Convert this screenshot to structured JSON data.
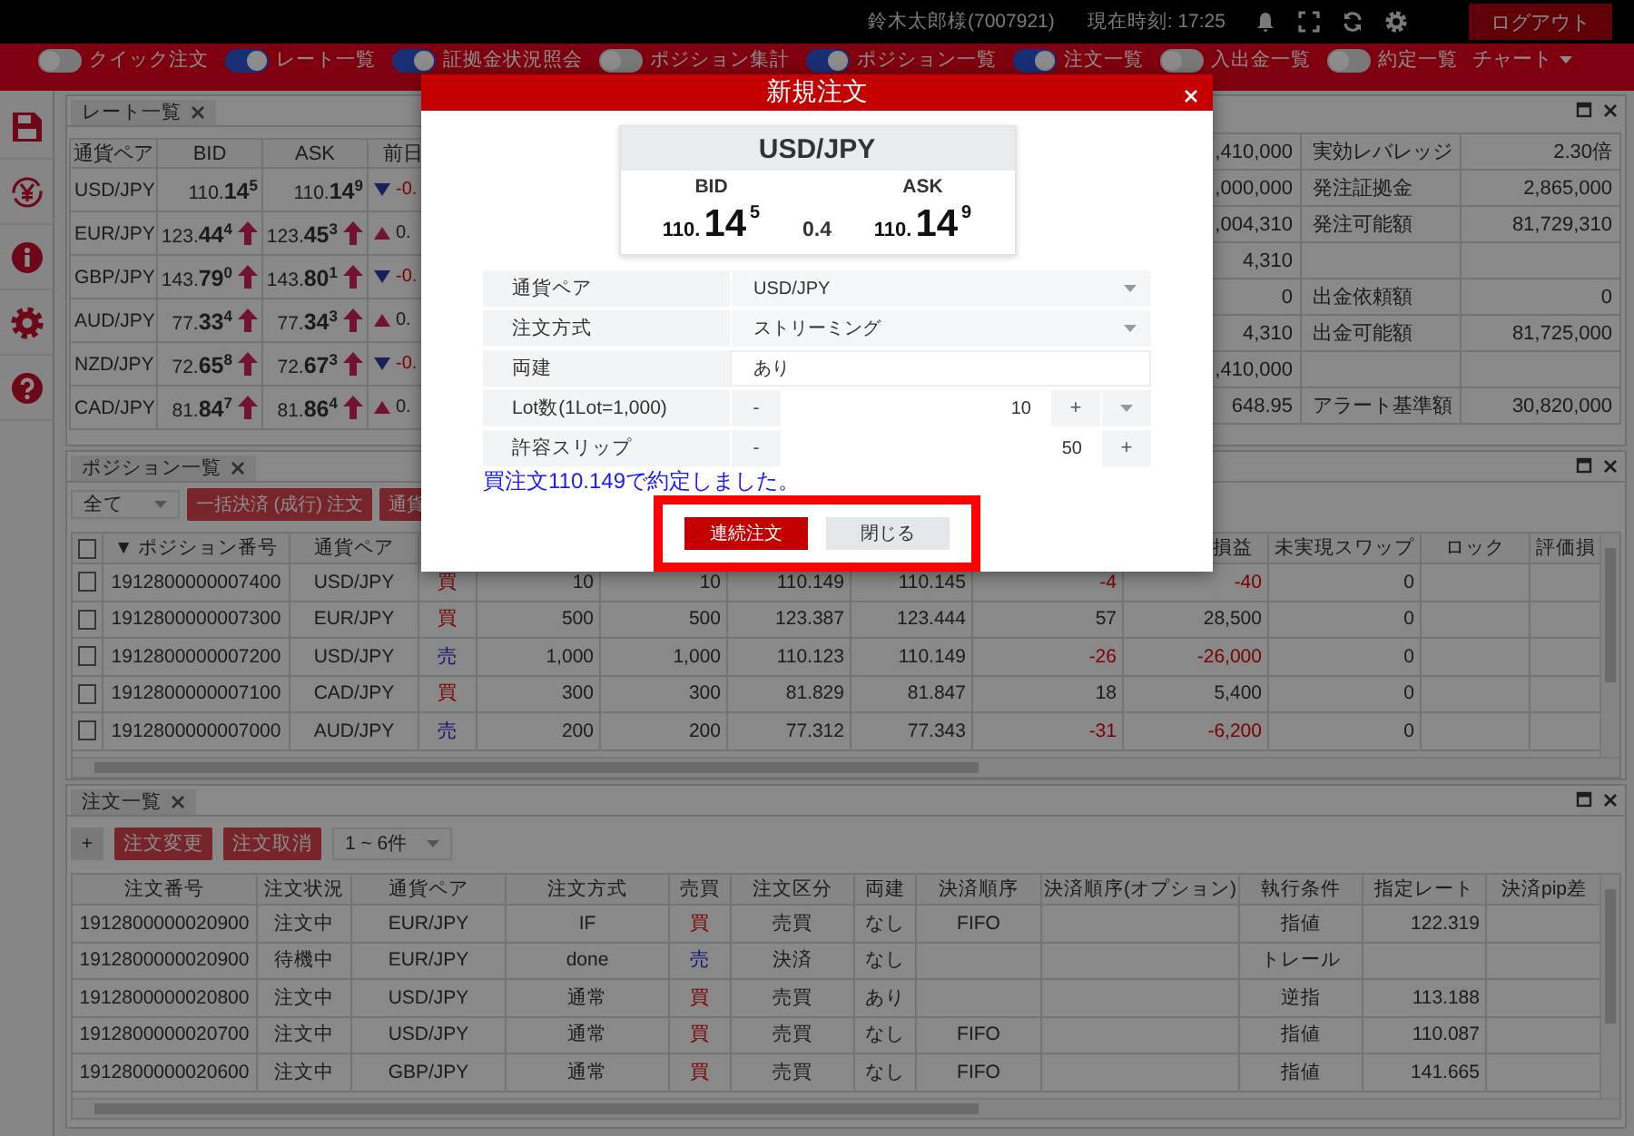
{
  "top_bar": {
    "user": "鈴木太郎様(7007921)",
    "clock": "現在時刻: 17:25",
    "logout": "ログアウト"
  },
  "nav": {
    "toggles": [
      {
        "label": "クイック注文",
        "on": false
      },
      {
        "label": "レート一覧",
        "on": true
      },
      {
        "label": "証拠金状況照会",
        "on": true
      },
      {
        "label": "ポジション集計",
        "on": false
      },
      {
        "label": "ポジション一覧",
        "on": true
      },
      {
        "label": "注文一覧",
        "on": true
      },
      {
        "label": "入出金一覧",
        "on": false
      },
      {
        "label": "約定一覧",
        "on": false
      }
    ],
    "chart_menu": "チャート"
  },
  "rate_panel": {
    "tab": "レート一覧",
    "columns": [
      "通貨ペア",
      "BID",
      "ASK",
      "前日"
    ],
    "rows": [
      {
        "pair": "USD/JPY",
        "bid": "110.**14**$^{5}$",
        "bid_up": false,
        "ask": "110.**14**$^{9}$",
        "ask_up": false,
        "change_down": true,
        "change": "-0."
      },
      {
        "pair": "EUR/JPY",
        "bid": "123.**44**$^{4}$",
        "bid_up": true,
        "ask": "123.**45**$^{3}$",
        "ask_up": true,
        "change_down": false,
        "change": "0."
      },
      {
        "pair": "GBP/JPY",
        "bid": "143.**79**$^{0}$",
        "bid_up": true,
        "ask": "143.**80**$^{1}$",
        "ask_up": true,
        "change_down": true,
        "change": "-0."
      },
      {
        "pair": "AUD/JPY",
        "bid": "77.**33**$^{4}$",
        "bid_up": true,
        "ask": "77.**34**$^{3}$",
        "ask_up": true,
        "change_down": false,
        "change": "0."
      },
      {
        "pair": "NZD/JPY",
        "bid": "72.**65**$^{8}$",
        "bid_up": true,
        "ask": "72.**67**$^{3}$",
        "ask_up": true,
        "change_down": true,
        "change": "-0."
      },
      {
        "pair": "CAD/JPY",
        "bid": "81.**84**$^{7}$",
        "bid_up": true,
        "ask": "81.**86**$^{4}$",
        "ask_up": true,
        "change_down": false,
        "change": "0."
      }
    ]
  },
  "account_panel": {
    "rows": [
      {
        "value_1": ",410,000",
        "label_2": "実効レバレッジ",
        "value_2": "2.30倍"
      },
      {
        "value_1": ",000,000",
        "label_2": "発注証拠金",
        "value_2": "2,865,000"
      },
      {
        "value_1": ",004,310",
        "label_2": "発注可能額",
        "value_2": "81,729,310"
      },
      {
        "value_1": "4,310"
      },
      {
        "value_1": "0",
        "label_2": "出金依頼額",
        "value_2": "0"
      },
      {
        "value_1": "4,310",
        "label_2": "出金可能額",
        "value_2": "81,725,000"
      },
      {
        "value_1": ",410,000"
      },
      {
        "value_1": "648.95",
        "label_2": "アラート基準額",
        "value_2": "30,820,000"
      }
    ]
  },
  "position_panel": {
    "tab": "ポジション一覧",
    "filter": "全て",
    "buttons": [
      "一括決済 (成行) 注文",
      "通貨"
    ],
    "select_all_checked": false,
    "columns": {
      "number": "▼ ポジション番号",
      "pair": "通貨ペア",
      "pl": "損益",
      "swap": "未実現スワップ",
      "lock": "ロック",
      "column_13": "評価損"
    },
    "rows": [
      {
        "checked": false,
        "number": "1912800000007400",
        "pair": "USD/JPY",
        "side": "買",
        "sell": false,
        "quantity": "10",
        "remaining": "10",
        "open_rate": "110.149",
        "current_rate": "110.145",
        "pips": "-4",
        "pl": "-40",
        "swap": "0",
        "loss": true
      },
      {
        "checked": false,
        "number": "1912800000007300",
        "pair": "EUR/JPY",
        "side": "買",
        "sell": false,
        "quantity": "500",
        "remaining": "500",
        "open_rate": "123.387",
        "current_rate": "123.444",
        "pips": "57",
        "pl": "28,500",
        "swap": "0",
        "loss": false
      },
      {
        "checked": false,
        "number": "1912800000007200",
        "pair": "USD/JPY",
        "side": "売",
        "sell": true,
        "quantity": "1,000",
        "remaining": "1,000",
        "open_rate": "110.123",
        "current_rate": "110.149",
        "pips": "-26",
        "pl": "-26,000",
        "swap": "0",
        "loss": true
      },
      {
        "checked": false,
        "number": "1912800000007100",
        "pair": "CAD/JPY",
        "side": "買",
        "sell": false,
        "quantity": "300",
        "remaining": "300",
        "open_rate": "81.829",
        "current_rate": "81.847",
        "pips": "18",
        "pl": "5,400",
        "swap": "0",
        "loss": false
      },
      {
        "checked": false,
        "number": "1912800000007000",
        "pair": "AUD/JPY",
        "side": "売",
        "sell": true,
        "quantity": "200",
        "remaining": "200",
        "open_rate": "77.312",
        "current_rate": "77.343",
        "pips": "-31",
        "pl": "-6,200",
        "swap": "0",
        "loss": true
      }
    ]
  },
  "order_panel": {
    "tab": "注文一覧",
    "buttons": [
      {
        "label": "+",
        "kind": "plain"
      },
      {
        "label": "注文変更",
        "kind": "danger"
      },
      {
        "label": "注文取消",
        "kind": "danger"
      }
    ],
    "page_select": "1 ~ 6件",
    "columns": {
      "number": "注文番号",
      "status": "注文状況",
      "pair": "通貨ペア",
      "method": "注文方式",
      "side": "売買",
      "category": "注文区分",
      "hedge": "両建",
      "settlement_order": "決済順序",
      "settlement_option": "決済順序(オプション)",
      "condition": "執行条件",
      "rate": "指定レート",
      "pip_diff": "決済pip差"
    },
    "rows": [
      {
        "number": "1912800000020900",
        "status": "注文中",
        "pair": "EUR/JPY",
        "method": "IF",
        "side": "買",
        "sell": false,
        "category": "売買",
        "hedge": "なし",
        "settlement_order": "FIFO",
        "condition": "指値",
        "rate": "122.319"
      },
      {
        "number": "1912800000020900",
        "status": "待機中",
        "pair": "EUR/JPY",
        "method": "done",
        "side": "売",
        "sell": true,
        "category": "決済",
        "hedge": "なし",
        "condition": "トレール"
      },
      {
        "number": "1912800000020800",
        "status": "注文中",
        "pair": "USD/JPY",
        "method": "通常",
        "side": "買",
        "sell": false,
        "category": "売買",
        "hedge": "あり",
        "condition": "逆指",
        "rate": "113.188"
      },
      {
        "number": "1912800000020700",
        "status": "注文中",
        "pair": "USD/JPY",
        "method": "通常",
        "side": "買",
        "sell": false,
        "category": "売買",
        "hedge": "なし",
        "settlement_order": "FIFO",
        "condition": "指値",
        "rate": "110.087"
      },
      {
        "number": "1912800000020600",
        "status": "注文中",
        "pair": "GBP/JPY",
        "method": "通常",
        "side": "買",
        "sell": false,
        "category": "売買",
        "hedge": "なし",
        "settlement_order": "FIFO",
        "condition": "指値",
        "rate": "141.665"
      }
    ]
  },
  "modal": {
    "title": "新規注文",
    "quote": {
      "pair": "USD/JPY",
      "bid_label": "BID",
      "ask_label": "ASK",
      "bid": {
        "big_figure": "110.",
        "pips": "14",
        "fraction": "5"
      },
      "spread": "0.4",
      "ask": {
        "big_figure": "110.",
        "pips": "14",
        "fraction": "9"
      }
    },
    "fields": [
      {
        "kind": "select",
        "label": "通貨ペア",
        "value": "USD/JPY"
      },
      {
        "kind": "select",
        "label": "注文方式",
        "value": "ストリーミング"
      },
      {
        "kind": "text",
        "label": "両建",
        "value": "あり"
      },
      {
        "kind": "stepper",
        "label": "Lot数(1Lot=1,000)",
        "minus": "-",
        "value": "10",
        "plus": "+",
        "has_menu": true
      },
      {
        "kind": "stepper",
        "label": "許容スリップ",
        "minus": "-",
        "value": "50",
        "plus": "+",
        "has_menu": false
      }
    ],
    "message": "買注文110.149で約定しました。",
    "buttons": [
      {
        "label": "連続注文",
        "kind": "primary"
      },
      {
        "label": "閉じる",
        "kind": "secondary"
      }
    ],
    "highlight_buttons": true
  }
}
